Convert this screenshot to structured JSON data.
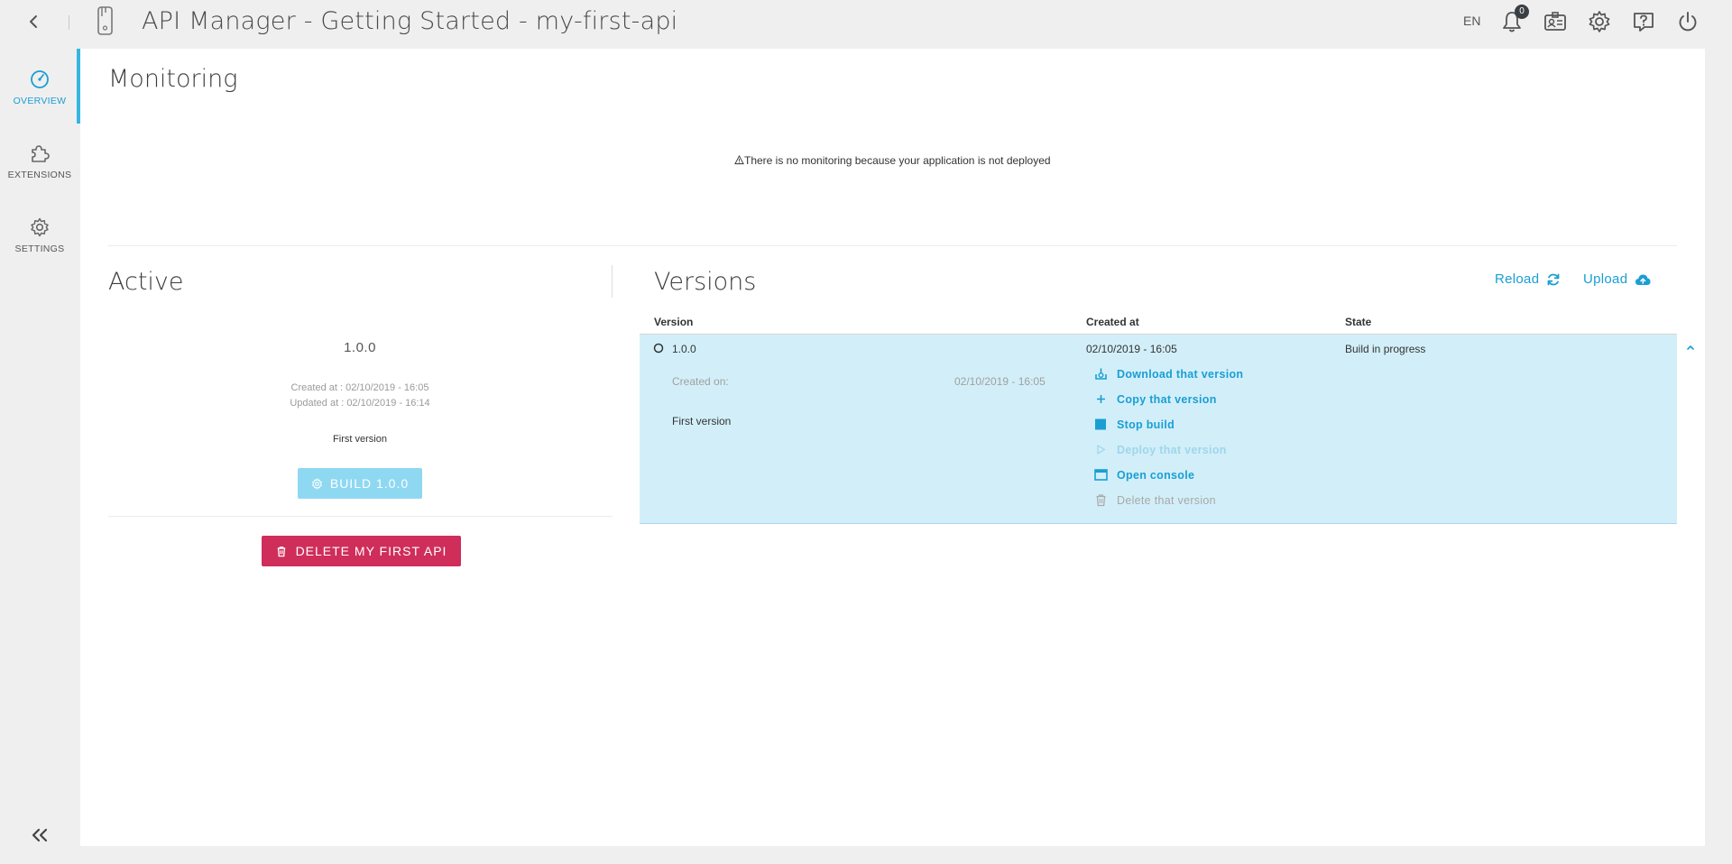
{
  "header": {
    "title": "API Manager - Getting Started - my-first-api",
    "language": "EN",
    "notifications_count": "0"
  },
  "sidebar": {
    "items": [
      {
        "label": "OVERVIEW",
        "icon": "gauge-icon",
        "active": true
      },
      {
        "label": "EXTENSIONS",
        "icon": "puzzle-icon",
        "active": false
      },
      {
        "label": "SETTINGS",
        "icon": "gear-icon",
        "active": false
      }
    ]
  },
  "monitoring": {
    "title": "Monitoring",
    "message": "There is no monitoring because your application is not deployed"
  },
  "active": {
    "title": "Active",
    "version": "1.0.0",
    "created_at": "Created at  : 02/10/2019 - 16:05",
    "updated_at": "Updated at : 02/10/2019 - 16:14",
    "description": "First version",
    "build_label": "BUILD 1.0.0",
    "delete_label": "DELETE MY FIRST API"
  },
  "versions": {
    "title": "Versions",
    "reload_label": "Reload",
    "upload_label": "Upload",
    "columns": [
      "Version",
      "Created at",
      "State"
    ],
    "rows": [
      {
        "version": "1.0.0",
        "created_at": "02/10/2019 - 16:05",
        "state": "Build in progress",
        "created_on_label": "Created on:",
        "created_on_value": "02/10/2019 - 16:05",
        "description": "First version",
        "actions": {
          "download": "Download that version",
          "copy": "Copy that version",
          "stop": "Stop build",
          "deploy": "Deploy that version",
          "console": "Open console",
          "delete": "Delete that version"
        }
      }
    ]
  },
  "colors": {
    "accent": "#1a9ed4",
    "row_highlight": "#d2eff9",
    "danger": "#cf2d5a",
    "build_button": "#8fd8f2"
  }
}
